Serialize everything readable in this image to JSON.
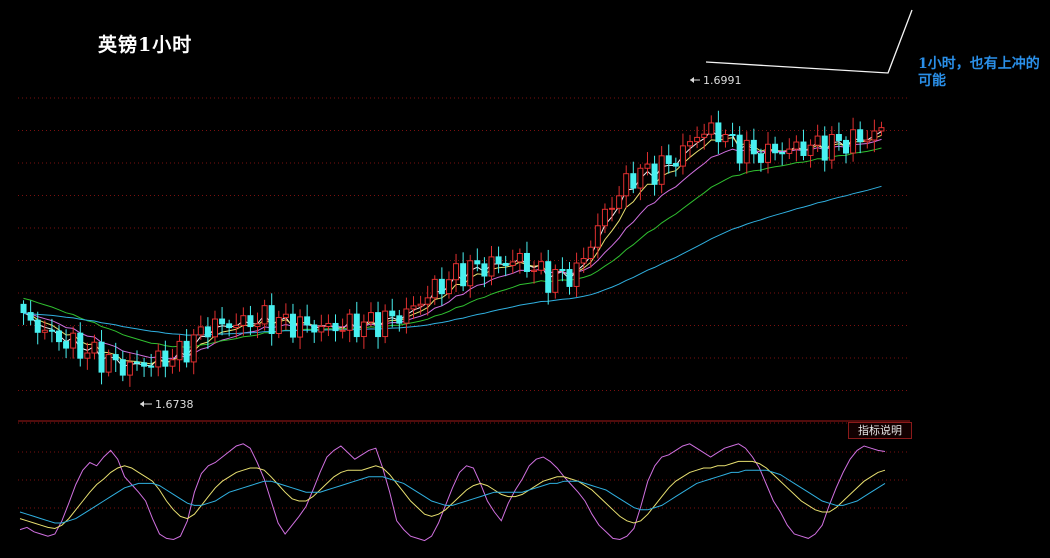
{
  "title": "英镑1小时",
  "annotation": "1小时，也有上冲的可能",
  "indicator_button": "指标说明",
  "chart_data": [
    {
      "type": "candlestick",
      "title": "英镑1小时",
      "high_marker": "1.6991",
      "low_marker": "1.6738",
      "colors": {
        "up": "#e03030",
        "down": "#48f0f0",
        "grid": "#7a1010",
        "ma_white": "#f2f2f2",
        "ma_yellow": "#e8e070",
        "ma_magenta": "#d070e0",
        "ma_green": "#30c030",
        "ma_cyan": "#30b0e0"
      },
      "price_path": [
        [
          0,
          1.6795
        ],
        [
          5,
          1.6775
        ],
        [
          10,
          1.676
        ],
        [
          14,
          1.6748
        ],
        [
          18,
          1.6752
        ],
        [
          22,
          1.676
        ],
        [
          26,
          1.6788
        ],
        [
          30,
          1.679
        ],
        [
          34,
          1.6795
        ],
        [
          38,
          1.679
        ],
        [
          42,
          1.6786
        ],
        [
          46,
          1.6788
        ],
        [
          50,
          1.6792
        ],
        [
          54,
          1.68
        ],
        [
          58,
          1.6824
        ],
        [
          62,
          1.6842
        ],
        [
          66,
          1.6848
        ],
        [
          70,
          1.6852
        ],
        [
          74,
          1.6835
        ],
        [
          78,
          1.684
        ],
        [
          82,
          1.6898
        ],
        [
          86,
          1.6935
        ],
        [
          89,
          1.694
        ],
        [
          92,
          1.695
        ],
        [
          95,
          1.6975
        ],
        [
          98,
          1.6978
        ],
        [
          100,
          1.6965
        ],
        [
          103,
          1.6955
        ],
        [
          106,
          1.6958
        ],
        [
          110,
          1.6962
        ],
        [
          114,
          1.6965
        ],
        [
          118,
          1.697
        ],
        [
          121,
          1.6978
        ]
      ],
      "ma_lines": [
        {
          "key": "ma_white",
          "lag": 3
        },
        {
          "key": "ma_yellow",
          "lag": 6
        },
        {
          "key": "ma_magenta",
          "lag": 12
        },
        {
          "key": "ma_green",
          "lag": 24
        },
        {
          "key": "ma_cyan",
          "lag": 60
        }
      ],
      "ylim": [
        1.671,
        1.701
      ],
      "grid": true
    },
    {
      "type": "line",
      "subtype": "kdj-oscillator",
      "ylim": [
        0,
        100
      ],
      "lines": [
        {
          "key": "ma_magenta",
          "values": [
            14,
            16,
            12,
            10,
            8,
            10,
            22,
            38,
            55,
            68,
            75,
            72,
            80,
            86,
            78,
            62,
            55,
            48,
            40,
            24,
            10,
            6,
            5,
            8,
            22,
            48,
            65,
            72,
            75,
            80,
            85,
            90,
            92,
            88,
            75,
            60,
            40,
            20,
            10,
            18,
            26,
            35,
            50,
            66,
            80,
            86,
            90,
            84,
            78,
            82,
            86,
            88,
            70,
            48,
            22,
            14,
            8,
            6,
            4,
            8,
            20,
            36,
            52,
            66,
            72,
            70,
            56,
            40,
            30,
            22,
            38,
            50,
            60,
            72,
            78,
            80,
            76,
            70,
            62,
            55,
            48,
            40,
            28,
            18,
            12,
            6,
            5,
            8,
            15,
            35,
            58,
            72,
            80,
            82,
            86,
            90,
            92,
            88,
            84,
            80,
            84,
            88,
            90,
            92,
            88,
            80,
            70,
            55,
            40,
            30,
            18,
            10,
            8,
            6,
            10,
            18,
            36,
            52,
            66,
            78,
            86,
            90,
            88,
            86,
            85
          ]
        },
        {
          "key": "ma_yellow",
          "values": [
            24,
            22,
            20,
            18,
            16,
            15,
            18,
            24,
            32,
            40,
            48,
            55,
            60,
            66,
            70,
            72,
            70,
            66,
            62,
            58,
            50,
            40,
            32,
            26,
            24,
            28,
            36,
            44,
            52,
            58,
            62,
            66,
            68,
            70,
            70,
            68,
            62,
            55,
            48,
            42,
            40,
            40,
            44,
            50,
            56,
            62,
            66,
            68,
            68,
            68,
            70,
            72,
            70,
            64,
            56,
            48,
            40,
            34,
            28,
            26,
            28,
            32,
            38,
            44,
            50,
            54,
            56,
            54,
            50,
            46,
            44,
            44,
            46,
            50,
            54,
            58,
            60,
            62,
            62,
            60,
            58,
            54,
            50,
            44,
            38,
            32,
            26,
            22,
            20,
            22,
            28,
            36,
            44,
            52,
            58,
            62,
            66,
            68,
            70,
            70,
            72,
            72,
            74,
            76,
            76,
            76,
            74,
            70,
            64,
            58,
            52,
            46,
            40,
            36,
            32,
            30,
            30,
            34,
            40,
            46,
            52,
            58,
            62,
            66,
            68
          ]
        },
        {
          "key": "ma_cyan",
          "values": [
            30,
            28,
            26,
            24,
            22,
            20,
            20,
            22,
            24,
            28,
            32,
            36,
            40,
            44,
            48,
            52,
            54,
            56,
            56,
            56,
            54,
            50,
            46,
            42,
            38,
            36,
            36,
            38,
            40,
            44,
            48,
            50,
            52,
            54,
            56,
            58,
            58,
            56,
            54,
            52,
            50,
            48,
            48,
            48,
            50,
            52,
            54,
            56,
            58,
            60,
            62,
            62,
            62,
            60,
            58,
            56,
            52,
            48,
            44,
            40,
            38,
            36,
            36,
            38,
            40,
            42,
            44,
            46,
            48,
            48,
            48,
            48,
            48,
            50,
            52,
            54,
            56,
            56,
            58,
            58,
            58,
            56,
            54,
            52,
            50,
            46,
            42,
            38,
            34,
            32,
            32,
            34,
            36,
            40,
            44,
            48,
            52,
            56,
            58,
            60,
            62,
            64,
            66,
            66,
            68,
            68,
            68,
            68,
            66,
            64,
            60,
            56,
            52,
            48,
            44,
            40,
            38,
            36,
            36,
            38,
            40,
            44,
            48,
            52,
            56
          ]
        }
      ]
    }
  ]
}
